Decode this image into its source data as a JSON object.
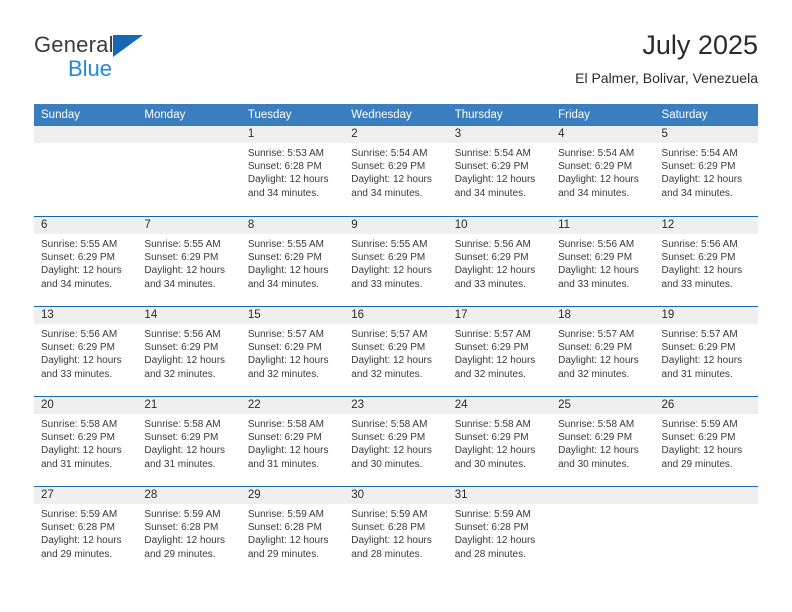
{
  "logo": {
    "general_text": "General",
    "blue_text": "Blue",
    "triangle_color": "#1668b3",
    "blue_color": "#1f8ae0"
  },
  "header": {
    "title": "July 2025",
    "location": "El Palmer, Bolivar, Venezuela"
  },
  "theme": {
    "header_bg": "#3a7ebf",
    "row_divider": "#1668b3",
    "day_band_bg": "#efefef"
  },
  "weekdays": [
    "Sunday",
    "Monday",
    "Tuesday",
    "Wednesday",
    "Thursday",
    "Friday",
    "Saturday"
  ],
  "labels": {
    "sunrise_prefix": "Sunrise:",
    "sunset_prefix": "Sunset:",
    "daylight_prefix": "Daylight:"
  },
  "weeks": [
    [
      {
        "day": "",
        "empty": true
      },
      {
        "day": "",
        "empty": true
      },
      {
        "day": "1",
        "sunrise": "Sunrise: 5:53 AM",
        "sunset": "Sunset: 6:28 PM",
        "daylight_line1": "Daylight: 12 hours",
        "daylight_line2": "and 34 minutes."
      },
      {
        "day": "2",
        "sunrise": "Sunrise: 5:54 AM",
        "sunset": "Sunset: 6:29 PM",
        "daylight_line1": "Daylight: 12 hours",
        "daylight_line2": "and 34 minutes."
      },
      {
        "day": "3",
        "sunrise": "Sunrise: 5:54 AM",
        "sunset": "Sunset: 6:29 PM",
        "daylight_line1": "Daylight: 12 hours",
        "daylight_line2": "and 34 minutes."
      },
      {
        "day": "4",
        "sunrise": "Sunrise: 5:54 AM",
        "sunset": "Sunset: 6:29 PM",
        "daylight_line1": "Daylight: 12 hours",
        "daylight_line2": "and 34 minutes."
      },
      {
        "day": "5",
        "sunrise": "Sunrise: 5:54 AM",
        "sunset": "Sunset: 6:29 PM",
        "daylight_line1": "Daylight: 12 hours",
        "daylight_line2": "and 34 minutes."
      }
    ],
    [
      {
        "day": "6",
        "sunrise": "Sunrise: 5:55 AM",
        "sunset": "Sunset: 6:29 PM",
        "daylight_line1": "Daylight: 12 hours",
        "daylight_line2": "and 34 minutes."
      },
      {
        "day": "7",
        "sunrise": "Sunrise: 5:55 AM",
        "sunset": "Sunset: 6:29 PM",
        "daylight_line1": "Daylight: 12 hours",
        "daylight_line2": "and 34 minutes."
      },
      {
        "day": "8",
        "sunrise": "Sunrise: 5:55 AM",
        "sunset": "Sunset: 6:29 PM",
        "daylight_line1": "Daylight: 12 hours",
        "daylight_line2": "and 34 minutes."
      },
      {
        "day": "9",
        "sunrise": "Sunrise: 5:55 AM",
        "sunset": "Sunset: 6:29 PM",
        "daylight_line1": "Daylight: 12 hours",
        "daylight_line2": "and 33 minutes."
      },
      {
        "day": "10",
        "sunrise": "Sunrise: 5:56 AM",
        "sunset": "Sunset: 6:29 PM",
        "daylight_line1": "Daylight: 12 hours",
        "daylight_line2": "and 33 minutes."
      },
      {
        "day": "11",
        "sunrise": "Sunrise: 5:56 AM",
        "sunset": "Sunset: 6:29 PM",
        "daylight_line1": "Daylight: 12 hours",
        "daylight_line2": "and 33 minutes."
      },
      {
        "day": "12",
        "sunrise": "Sunrise: 5:56 AM",
        "sunset": "Sunset: 6:29 PM",
        "daylight_line1": "Daylight: 12 hours",
        "daylight_line2": "and 33 minutes."
      }
    ],
    [
      {
        "day": "13",
        "sunrise": "Sunrise: 5:56 AM",
        "sunset": "Sunset: 6:29 PM",
        "daylight_line1": "Daylight: 12 hours",
        "daylight_line2": "and 33 minutes."
      },
      {
        "day": "14",
        "sunrise": "Sunrise: 5:56 AM",
        "sunset": "Sunset: 6:29 PM",
        "daylight_line1": "Daylight: 12 hours",
        "daylight_line2": "and 32 minutes."
      },
      {
        "day": "15",
        "sunrise": "Sunrise: 5:57 AM",
        "sunset": "Sunset: 6:29 PM",
        "daylight_line1": "Daylight: 12 hours",
        "daylight_line2": "and 32 minutes."
      },
      {
        "day": "16",
        "sunrise": "Sunrise: 5:57 AM",
        "sunset": "Sunset: 6:29 PM",
        "daylight_line1": "Daylight: 12 hours",
        "daylight_line2": "and 32 minutes."
      },
      {
        "day": "17",
        "sunrise": "Sunrise: 5:57 AM",
        "sunset": "Sunset: 6:29 PM",
        "daylight_line1": "Daylight: 12 hours",
        "daylight_line2": "and 32 minutes."
      },
      {
        "day": "18",
        "sunrise": "Sunrise: 5:57 AM",
        "sunset": "Sunset: 6:29 PM",
        "daylight_line1": "Daylight: 12 hours",
        "daylight_line2": "and 32 minutes."
      },
      {
        "day": "19",
        "sunrise": "Sunrise: 5:57 AM",
        "sunset": "Sunset: 6:29 PM",
        "daylight_line1": "Daylight: 12 hours",
        "daylight_line2": "and 31 minutes."
      }
    ],
    [
      {
        "day": "20",
        "sunrise": "Sunrise: 5:58 AM",
        "sunset": "Sunset: 6:29 PM",
        "daylight_line1": "Daylight: 12 hours",
        "daylight_line2": "and 31 minutes."
      },
      {
        "day": "21",
        "sunrise": "Sunrise: 5:58 AM",
        "sunset": "Sunset: 6:29 PM",
        "daylight_line1": "Daylight: 12 hours",
        "daylight_line2": "and 31 minutes."
      },
      {
        "day": "22",
        "sunrise": "Sunrise: 5:58 AM",
        "sunset": "Sunset: 6:29 PM",
        "daylight_line1": "Daylight: 12 hours",
        "daylight_line2": "and 31 minutes."
      },
      {
        "day": "23",
        "sunrise": "Sunrise: 5:58 AM",
        "sunset": "Sunset: 6:29 PM",
        "daylight_line1": "Daylight: 12 hours",
        "daylight_line2": "and 30 minutes."
      },
      {
        "day": "24",
        "sunrise": "Sunrise: 5:58 AM",
        "sunset": "Sunset: 6:29 PM",
        "daylight_line1": "Daylight: 12 hours",
        "daylight_line2": "and 30 minutes."
      },
      {
        "day": "25",
        "sunrise": "Sunrise: 5:58 AM",
        "sunset": "Sunset: 6:29 PM",
        "daylight_line1": "Daylight: 12 hours",
        "daylight_line2": "and 30 minutes."
      },
      {
        "day": "26",
        "sunrise": "Sunrise: 5:59 AM",
        "sunset": "Sunset: 6:29 PM",
        "daylight_line1": "Daylight: 12 hours",
        "daylight_line2": "and 29 minutes."
      }
    ],
    [
      {
        "day": "27",
        "sunrise": "Sunrise: 5:59 AM",
        "sunset": "Sunset: 6:28 PM",
        "daylight_line1": "Daylight: 12 hours",
        "daylight_line2": "and 29 minutes."
      },
      {
        "day": "28",
        "sunrise": "Sunrise: 5:59 AM",
        "sunset": "Sunset: 6:28 PM",
        "daylight_line1": "Daylight: 12 hours",
        "daylight_line2": "and 29 minutes."
      },
      {
        "day": "29",
        "sunrise": "Sunrise: 5:59 AM",
        "sunset": "Sunset: 6:28 PM",
        "daylight_line1": "Daylight: 12 hours",
        "daylight_line2": "and 29 minutes."
      },
      {
        "day": "30",
        "sunrise": "Sunrise: 5:59 AM",
        "sunset": "Sunset: 6:28 PM",
        "daylight_line1": "Daylight: 12 hours",
        "daylight_line2": "and 28 minutes."
      },
      {
        "day": "31",
        "sunrise": "Sunrise: 5:59 AM",
        "sunset": "Sunset: 6:28 PM",
        "daylight_line1": "Daylight: 12 hours",
        "daylight_line2": "and 28 minutes."
      },
      {
        "day": "",
        "empty": true
      },
      {
        "day": "",
        "empty": true
      }
    ]
  ]
}
